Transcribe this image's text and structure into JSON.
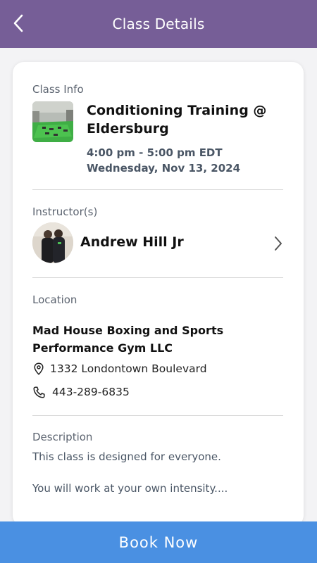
{
  "header": {
    "title": "Class Details",
    "back_icon": "chevron-left-icon"
  },
  "class_info": {
    "label": "Class Info",
    "title": "Conditioning Training @ Eldersburg",
    "time": "4:00 pm - 5:00 pm EDT",
    "date": "Wednesday, Nov 13, 2024"
  },
  "instructor": {
    "label": "Instructor(s)",
    "name": "Andrew Hill Jr",
    "chevron_icon": "chevron-right-icon"
  },
  "location": {
    "label": "Location",
    "name": "Mad House Boxing and Sports Performance Gym LLC",
    "address": "1332 Londontown Boulevard",
    "phone": "443-289-6835",
    "address_icon": "map-pin-icon",
    "phone_icon": "phone-icon"
  },
  "description": {
    "label": "Description",
    "line1": "This class is designed for everyone.",
    "line2": "You will work at your own intensity...."
  },
  "footer": {
    "book_label": "Book Now"
  },
  "colors": {
    "header_bg": "#765e97",
    "book_button_bg": "#4a90e2",
    "muted_text": "#4a5665"
  }
}
